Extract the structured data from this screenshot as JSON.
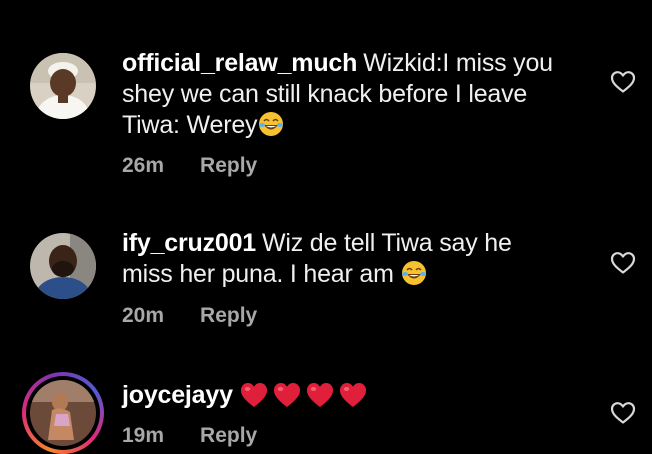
{
  "comments": [
    {
      "username": "official_relaw_much",
      "text_line1": "Wizkid:I miss you",
      "text_line2": "shey we can still knack before I leave",
      "text_line3": "Tiwa: Werey",
      "emoji": "face-with-tears-of-joy",
      "time": "26m",
      "reply_label": "Reply"
    },
    {
      "username": "ify_cruz001",
      "text_line1": "Wiz de tell Tiwa say he",
      "text_line2": "miss her puna. I hear am",
      "emoji": "face-with-tears-of-joy",
      "time": "20m",
      "reply_label": "Reply"
    },
    {
      "username": "joycejayy",
      "emoji": "red-heart",
      "emoji_count": 4,
      "time": "19m",
      "reply_label": "Reply"
    }
  ],
  "icons": {
    "like": "heart-outline-icon",
    "laugh": "face-with-tears-of-joy",
    "heart": "red-heart"
  },
  "colors": {
    "background": "#000000",
    "text": "#f5f5f5",
    "meta": "#a8a8a8",
    "heart": "#e0203a"
  }
}
